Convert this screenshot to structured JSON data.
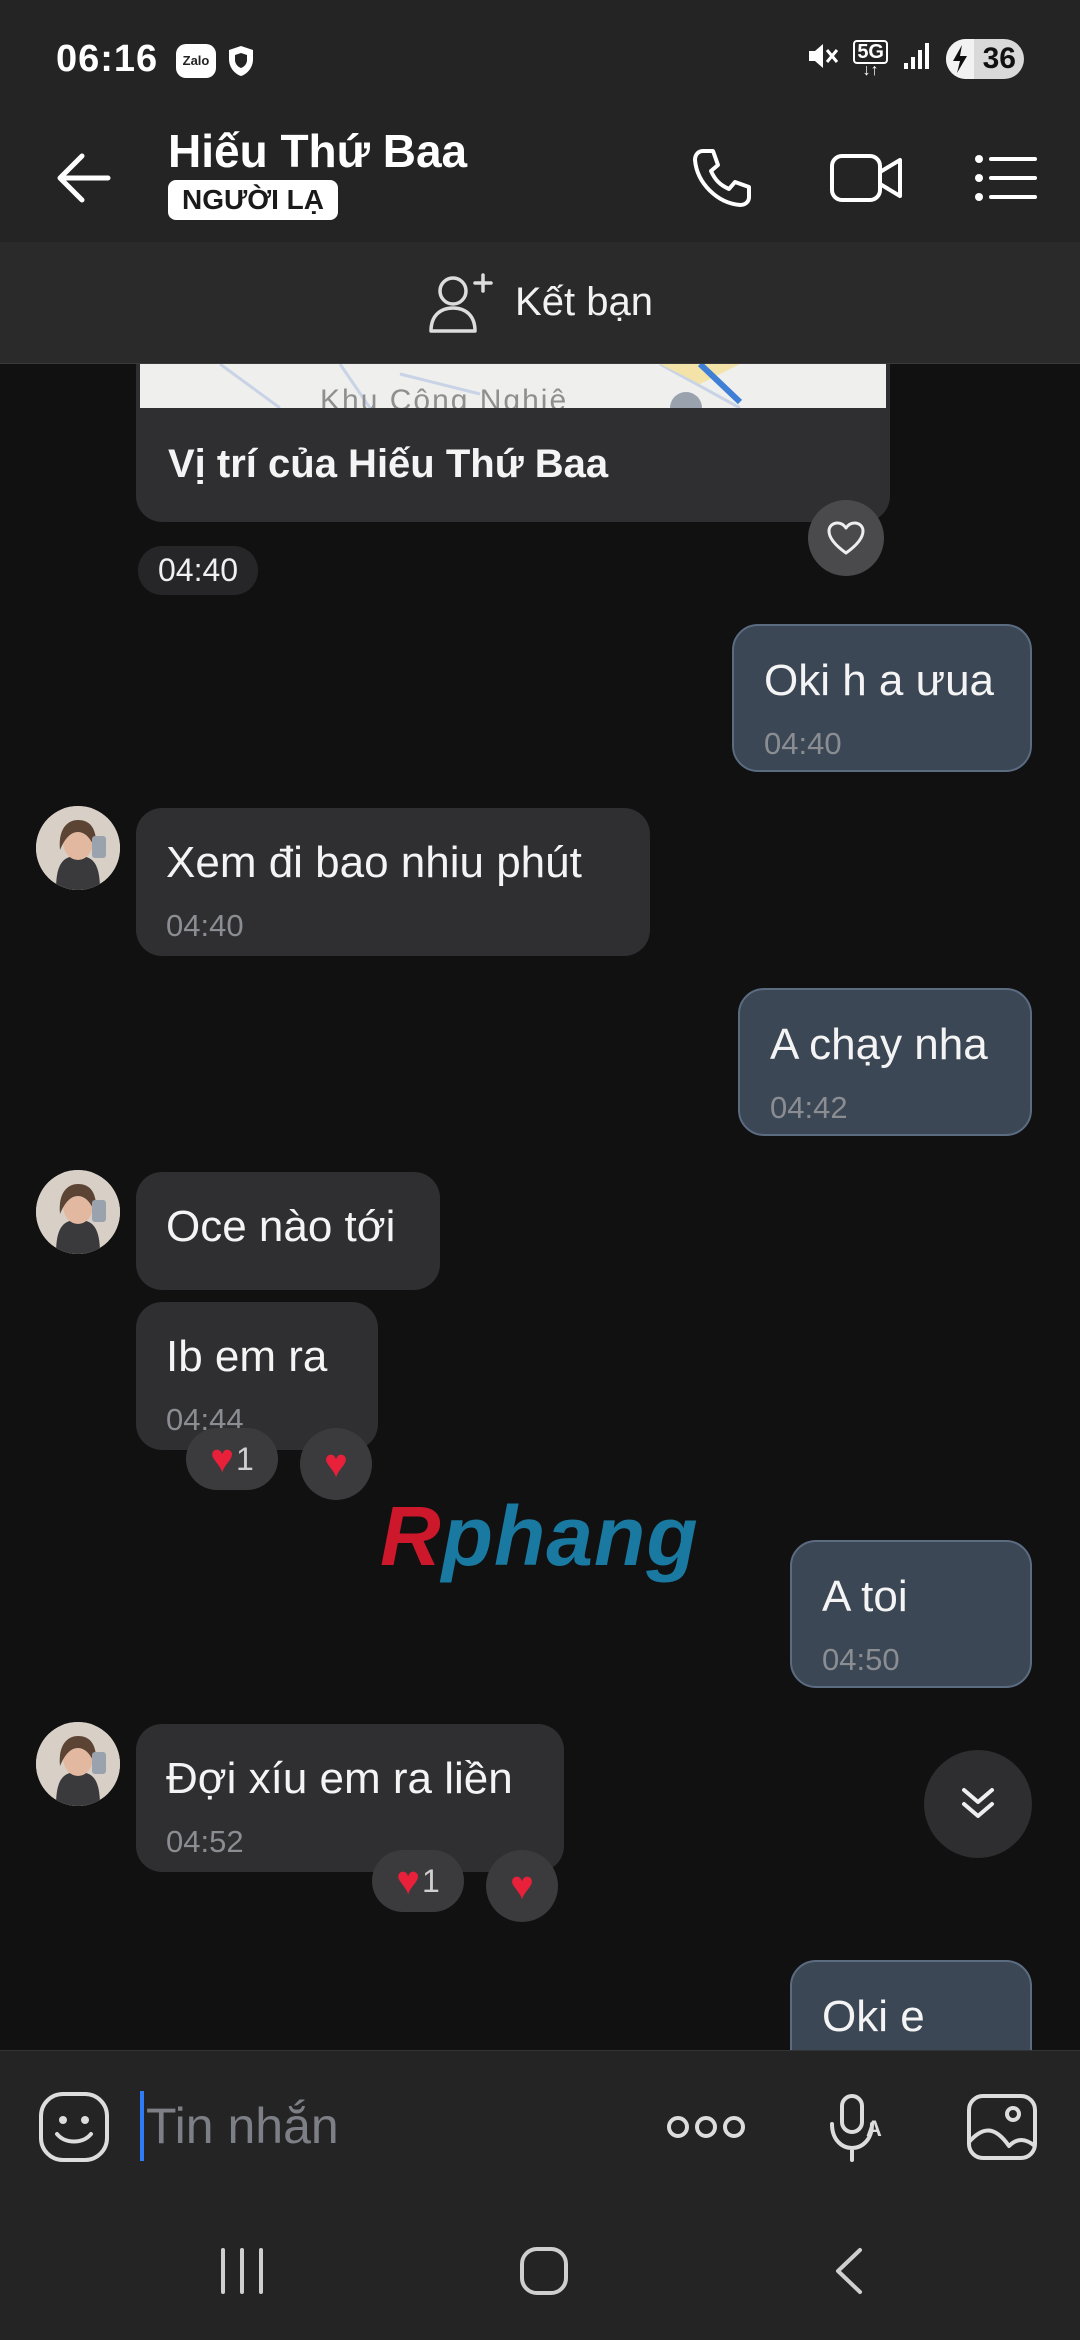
{
  "status_bar": {
    "time": "06:16",
    "zalo_badge": "Zalo",
    "network": "5G",
    "battery": "36"
  },
  "header": {
    "name": "Hiếu Thứ Baa",
    "badge": "NGƯỜI LẠ"
  },
  "add_friend": {
    "label": "Kết bạn"
  },
  "location_card": {
    "map_text": "Khu Công Nghiệ",
    "title": "Vị trí của Hiếu Thứ Baa"
  },
  "time_chip": "04:40",
  "messages": [
    {
      "text": "Oki h a ưua",
      "time": "04:40",
      "direction": "out"
    },
    {
      "text": "Xem đi bao nhiu phút",
      "time": "04:40",
      "direction": "in"
    },
    {
      "text": "A chạy nha",
      "time": "04:42",
      "direction": "out"
    },
    {
      "text": "Oce nào tới",
      "time": "",
      "direction": "in"
    },
    {
      "text": "Ib em ra",
      "time": "04:44",
      "direction": "in",
      "reaction_count": "1"
    },
    {
      "text": "A toi",
      "time": "04:50",
      "direction": "out"
    },
    {
      "text": "Đợi xíu em ra liền",
      "time": "04:52",
      "direction": "in",
      "reaction_count": "1"
    },
    {
      "text": "Oki e",
      "time": "",
      "direction": "out"
    }
  ],
  "watermark": {
    "r": "R",
    "rest": "phang"
  },
  "input": {
    "placeholder": "Tin nhắn"
  },
  "colors": {
    "incoming_bubble": "#2f2f31",
    "outgoing_bubble": "#3c4755",
    "background": "#111112",
    "heart": "#e8203a"
  },
  "icons": [
    "back-arrow-icon",
    "phone-icon",
    "video-camera-icon",
    "menu-list-icon",
    "add-person-icon",
    "heart-outline-icon",
    "chevron-double-down-icon",
    "emoji-icon",
    "more-dots-icon",
    "voice-text-icon",
    "image-icon",
    "recent-apps-icon",
    "home-icon",
    "nav-back-icon"
  ]
}
